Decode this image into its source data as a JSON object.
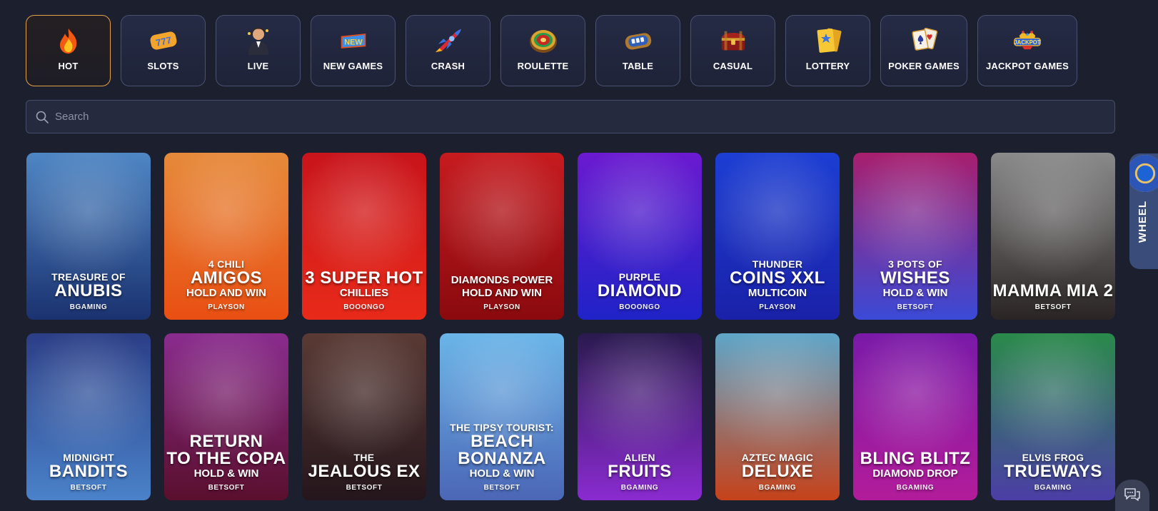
{
  "categories": [
    {
      "label": "HOT",
      "icon": "fire-icon",
      "active": true
    },
    {
      "label": "SLOTS",
      "icon": "slot-777-icon"
    },
    {
      "label": "LIVE",
      "icon": "live-dealer-icon"
    },
    {
      "label": "NEW GAMES",
      "icon": "new-badge-icon"
    },
    {
      "label": "CRASH",
      "icon": "rocket-icon"
    },
    {
      "label": "ROULETTE",
      "icon": "roulette-icon"
    },
    {
      "label": "TABLE",
      "icon": "card-table-icon"
    },
    {
      "label": "CASUAL",
      "icon": "treasure-chest-icon"
    },
    {
      "label": "LOTTERY",
      "icon": "lottery-ticket-icon"
    },
    {
      "label": "POKER GAMES",
      "icon": "poker-cards-icon"
    },
    {
      "label": "JACKPOT GAMES",
      "icon": "jackpot-crown-icon"
    }
  ],
  "search": {
    "placeholder": "Search"
  },
  "games": [
    {
      "line1": "TREASURE OF",
      "line2": "ANUBIS",
      "line3": "",
      "provider": "BGAMING",
      "colors": [
        "#4e86c4",
        "#1b3270"
      ]
    },
    {
      "line1": "4 CHILI",
      "line2": "AMIGOS",
      "line3": "HOLD AND WIN",
      "provider": "PLAYSON",
      "colors": [
        "#e68a3a",
        "#e94f12"
      ]
    },
    {
      "line1": "",
      "line2": "3 SUPER HOT",
      "line3": "CHILLIES",
      "provider": "BOOONGO",
      "colors": [
        "#c8141b",
        "#e82a1a"
      ]
    },
    {
      "line1": "DIAMONDS POWER",
      "line2": "",
      "line3": "HOLD AND WIN",
      "provider": "PLAYSON",
      "colors": [
        "#c61b1f",
        "#8a0a0e"
      ]
    },
    {
      "line1": "PURPLE",
      "line2": "DIAMOND",
      "line3": "",
      "provider": "BOOONGO",
      "colors": [
        "#6b1ad0",
        "#1f23c7"
      ]
    },
    {
      "line1": "THUNDER",
      "line2": "COINS XXL",
      "line3": "MULTICOIN",
      "provider": "PLAYSON",
      "colors": [
        "#1c3ed3",
        "#1a21a8"
      ]
    },
    {
      "line1": "3 POTS OF",
      "line2": "WISHES",
      "line3": "HOLD & WIN",
      "provider": "BETSOFT",
      "colors": [
        "#a81f6e",
        "#3b4ad6"
      ]
    },
    {
      "line1": "",
      "line2": "MAMMA MIA 2",
      "line3": "",
      "provider": "BETSOFT",
      "colors": [
        "#8a8a8a",
        "#2a2424"
      ]
    },
    {
      "line1": "MIDNIGHT",
      "line2": "BANDITS",
      "line3": "",
      "provider": "BETSOFT",
      "colors": [
        "#2b3e86",
        "#4a82c9"
      ]
    },
    {
      "line1": "",
      "line2": "RETURN",
      "line3": "TO THE COPA",
      "line4": "HOLD & WIN",
      "provider": "BETSOFT",
      "colors": [
        "#8a2c8e",
        "#5a0f2d"
      ]
    },
    {
      "line1": "THE",
      "line2": "JEALOUS EX",
      "line3": "",
      "provider": "BETSOFT",
      "colors": [
        "#5a3a34",
        "#24161c"
      ]
    },
    {
      "line1": "THE TIPSY TOURIST:",
      "line2": "BEACH",
      "line3": "BONANZA",
      "line4": "HOLD & WIN",
      "provider": "BETSOFT",
      "colors": [
        "#6ab5e8",
        "#4b66b6"
      ]
    },
    {
      "line1": "ALIEN",
      "line2": "FRUITS",
      "line3": "",
      "provider": "BGAMING",
      "colors": [
        "#2a1a4f",
        "#8a2bd0"
      ]
    },
    {
      "line1": "AZTEC MAGIC",
      "line2": "DELUXE",
      "line3": "",
      "provider": "BGAMING",
      "colors": [
        "#5fa6c9",
        "#c6421a"
      ]
    },
    {
      "line1": "",
      "line2": "BLING BLITZ",
      "line3": "DIAMOND DROP",
      "provider": "BGAMING",
      "colors": [
        "#7a1aa8",
        "#b21c9a"
      ]
    },
    {
      "line1": "ELVIS FROG",
      "line2": "TRUEWAYS",
      "line3": "",
      "provider": "BGAMING",
      "colors": [
        "#2a8a4a",
        "#4b3ea6"
      ]
    }
  ],
  "wheel": {
    "label": "WHEEL"
  },
  "chat": {
    "icon": "chat-bubble-icon"
  }
}
